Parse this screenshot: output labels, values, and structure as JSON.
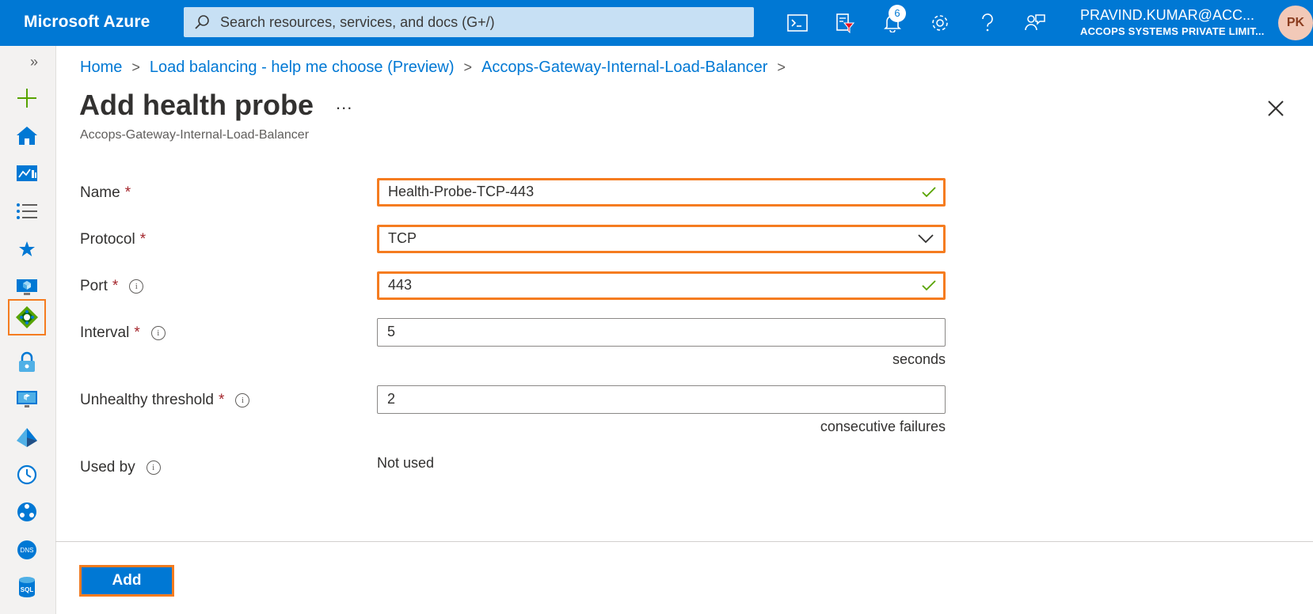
{
  "topbar": {
    "brand": "Microsoft Azure",
    "search_placeholder": "Search resources, services, and docs (G+/)",
    "notification_count": "6",
    "user_email": "PRAVIND.KUMAR@ACC...",
    "user_org": "ACCOPS SYSTEMS PRIVATE LIMIT...",
    "avatar_initials": "PK",
    "icons": [
      "cloud-shell-icon",
      "directory-filter-icon",
      "bell-icon",
      "gear-icon",
      "help-icon",
      "feedback-icon"
    ]
  },
  "rail": {
    "expand_glyph": "»",
    "items": [
      "create-resource-icon",
      "home-icon",
      "dashboard-icon",
      "all-services-icon",
      "favorites-star-icon",
      "virtual-machine-icon",
      "load-balancer-icon",
      "key-vault-icon",
      "virtual-desktop-icon",
      "azure-ad-icon",
      "clock-icon",
      "network-icon",
      "dns-icon",
      "sql-icon"
    ],
    "dns_label": "DNS",
    "sql_label": "SQL"
  },
  "breadcrumb": {
    "items": [
      "Home",
      "Load balancing - help me choose (Preview)",
      "Accops-Gateway-Internal-Load-Balancer"
    ],
    "separator": ">"
  },
  "page": {
    "title": "Add health probe",
    "more": "...",
    "subtitle": "Accops-Gateway-Internal-Load-Balancer"
  },
  "form": {
    "required_marker": "*",
    "info_glyph": "i",
    "name": {
      "label": "Name",
      "value": "Health-Probe-TCP-443"
    },
    "protocol": {
      "label": "Protocol",
      "value": "TCP"
    },
    "port": {
      "label": "Port",
      "value": "443"
    },
    "interval": {
      "label": "Interval",
      "value": "5",
      "unit": "seconds"
    },
    "threshold": {
      "label": "Unhealthy threshold",
      "value": "2",
      "unit": "consecutive failures"
    },
    "used_by": {
      "label": "Used by",
      "value": "Not used"
    }
  },
  "footer": {
    "add_label": "Add"
  },
  "colors": {
    "accent": "#0078d4",
    "highlight": "#f57c20",
    "valid": "#57a300"
  }
}
